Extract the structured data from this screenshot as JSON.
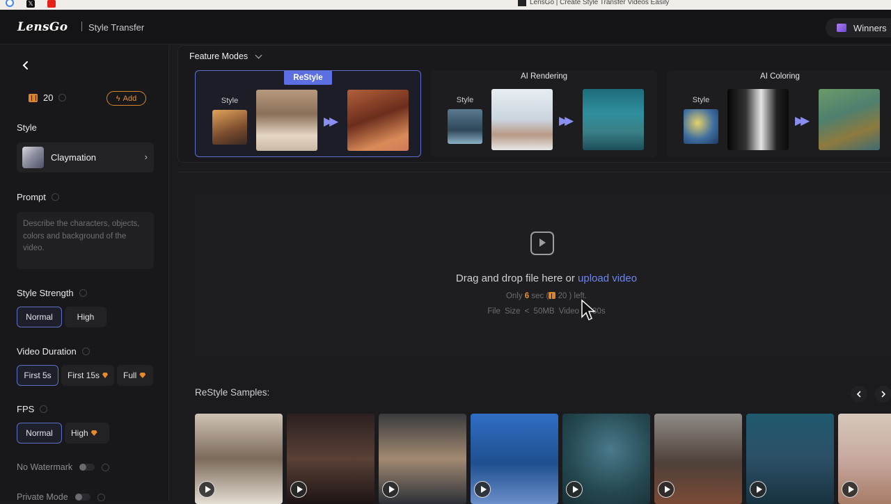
{
  "browser": {
    "tab_title": "LensGo | Create Style Transfer Videos Easily",
    "favicons": [
      "google-icon",
      "x-icon",
      "youtube-icon"
    ]
  },
  "header": {
    "logo": "LensGo",
    "subtitle": "Style Transfer",
    "winners_label": "Winners"
  },
  "sidebar": {
    "credits": "20",
    "add_label": "Add",
    "style_label": "Style",
    "style_value": "Claymation",
    "prompt_label": "Prompt",
    "prompt_placeholder": "Describe the characters, objects, colors and background of the video.",
    "strength_label": "Style Strength",
    "strength_options": [
      "Normal",
      "High"
    ],
    "strength_selected": "Normal",
    "duration_label": "Video Duration",
    "duration_options": [
      "First 5s",
      "First 15s",
      "Full"
    ],
    "duration_selected": "First 5s",
    "fps_label": "FPS",
    "fps_options": [
      "Normal",
      "High"
    ],
    "fps_selected": "Normal",
    "watermark_label": "No Watermark",
    "private_label": "Private Mode"
  },
  "feature_modes": {
    "label": "Feature Modes",
    "style_caption": "Style",
    "cards": [
      {
        "title": "ReStyle",
        "active": true
      },
      {
        "title": "AI Rendering",
        "active": false
      },
      {
        "title": "AI Coloring",
        "active": false
      }
    ]
  },
  "upload": {
    "main_text": "Drag and drop file here or ",
    "link_text": "upload video",
    "only": "Only ",
    "seconds": "6",
    "sec_text": " sec (",
    "credits_left": " 20 ) left.",
    "size_text": "File Size < 50MB   Video < 30s"
  },
  "samples": {
    "title": "ReStyle Samples:",
    "count": 8
  },
  "colors": {
    "accent": "#5b6fe3",
    "link": "#6d86ee",
    "credit_orange": "#e39237"
  }
}
